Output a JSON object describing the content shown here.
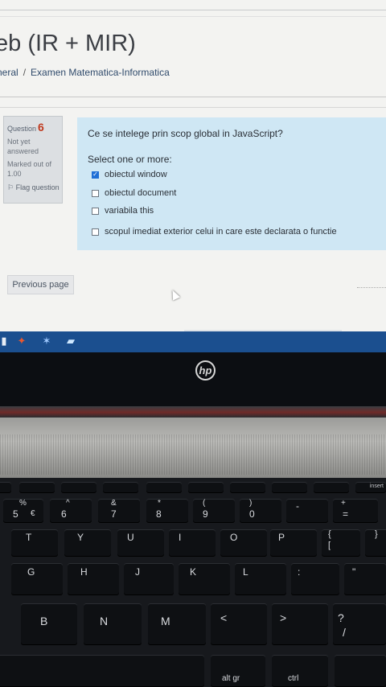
{
  "page": {
    "course_title": "eb (IR + MIR)",
    "breadcrumb": [
      "neral",
      "Examen Matematica-Informatica"
    ],
    "breadcrumb_separator": "/"
  },
  "question_info": {
    "label": "Question",
    "number": "6",
    "status": "Not yet answered",
    "marked": "Marked out of 1.00",
    "flag_label": "Flag question"
  },
  "question": {
    "text": "Ce se intelege prin scop global in JavaScript?",
    "prompt": "Select one or more:",
    "options": [
      {
        "label": "obiectul window",
        "checked": true
      },
      {
        "label": "obiectul document",
        "checked": false
      },
      {
        "label": "variabila this",
        "checked": false
      },
      {
        "label": "scopul imediat exterior celui in care este declarata o functie",
        "checked": false
      }
    ]
  },
  "navigation": {
    "previous_label": "Previous page"
  },
  "laptop": {
    "brand": "hp",
    "keys": {
      "insert": "insert",
      "percent": "%",
      "five": "5",
      "euro": "€",
      "caret": "^",
      "six": "6",
      "ampersand": "&",
      "seven": "7",
      "asterisk": "*",
      "eight": "8",
      "lparen": "(",
      "nine": "9",
      "rparen": ")",
      "zero": "0",
      "minus": "-",
      "plus": "+",
      "equals": "=",
      "t": "T",
      "y": "Y",
      "u": "U",
      "i": "I",
      "o": "O",
      "p": "P",
      "lbrace": "{",
      "lbracket": "[",
      "rbrace": "}",
      "g": "G",
      "h": "H",
      "j": "J",
      "k": "K",
      "l": "L",
      "quote": "\"",
      "b": "B",
      "n": "N",
      "m": "M",
      "less": "<",
      "greater": ">",
      "question": "?",
      "slash": "/",
      "altgr": "alt gr",
      "ctrl": "ctrl"
    }
  }
}
